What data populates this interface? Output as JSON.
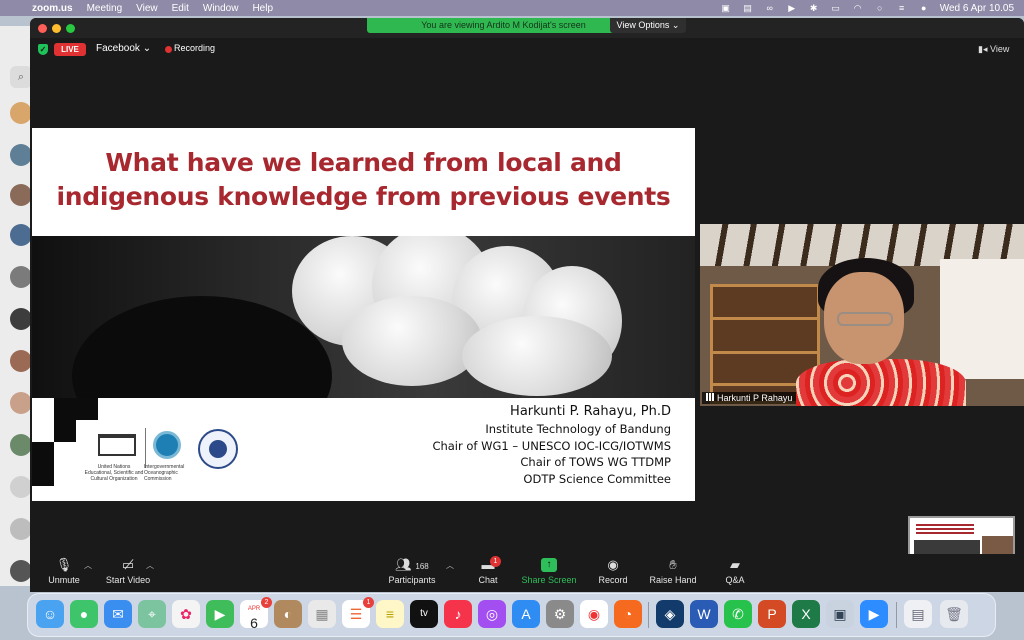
{
  "menubar": {
    "app_name": "zoom.us",
    "menus": [
      "Meeting",
      "View",
      "Edit",
      "Window",
      "Help"
    ],
    "clock": "Wed 6 Apr  10.05"
  },
  "banner": {
    "sharing_text": "You are viewing Ardito M Kodijat's screen",
    "view_options": "View Options ⌄"
  },
  "top_bar": {
    "live_label": "LIVE",
    "stream_target": "Facebook ⌄",
    "recording_label": "Recording",
    "view_label": "View"
  },
  "slide": {
    "title_line1": "What have we learned from local and",
    "title_line2": "indigenous knowledge from previous events",
    "speaker_name": "Harkunti P. Rahayu, Ph.D",
    "lines": [
      "Institute Technology of Bandung",
      "Chair of WG1 – UNESCO IOC-ICG/IOTWMS",
      "Chair of TOWS WG TTDMP",
      "ODTP Science Committee"
    ],
    "unesco_caption": "United Nations\nEducational, Scientific and\nCultural Organization",
    "ioc_caption": "Intergovernmental\nOceanographic\nCommission"
  },
  "video": {
    "participant_name": "Harkunti P Rahayu"
  },
  "toolbar": {
    "unmute": "Unmute",
    "start_video": "Start Video",
    "participants": "Participants",
    "participants_count": "168",
    "chat": "Chat",
    "chat_badge": "1",
    "share_screen": "Share Screen",
    "record": "Record",
    "raise_hand": "Raise Hand",
    "qa": "Q&A"
  },
  "dock": {
    "calendar_month": "APR",
    "calendar_day": "6",
    "calendar_badge": "2",
    "reminders_badge": "1"
  },
  "colors": {
    "accent_red": "#a8282f",
    "live_red": "#e03232",
    "share_green": "#2fbf5a"
  }
}
